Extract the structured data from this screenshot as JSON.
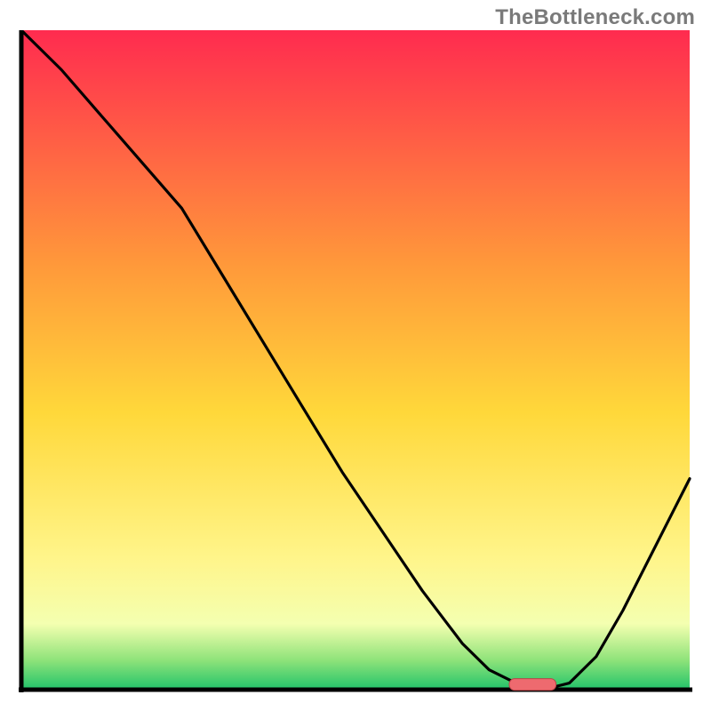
{
  "watermark": "TheBottleneck.com",
  "colors": {
    "gradient_top": "#ff2b4f",
    "gradient_mid_upper": "#ff9a3a",
    "gradient_mid": "#ffd83a",
    "gradient_mid_lower": "#fff58a",
    "gradient_low": "#f4ffb0",
    "gradient_green_light": "#8fe37a",
    "gradient_green": "#21c36a",
    "axis": "#000000",
    "curve": "#000000",
    "marker_fill": "#ee6a6f",
    "marker_stroke": "#b94448"
  },
  "chart_data": {
    "type": "line",
    "title": "",
    "xlabel": "",
    "ylabel": "",
    "xlim": [
      0,
      100
    ],
    "ylim": [
      0,
      100
    ],
    "series": [
      {
        "name": "bottleneck-curve",
        "x": [
          0,
          6,
          12,
          18,
          24,
          30,
          36,
          42,
          48,
          54,
          60,
          66,
          70,
          74,
          78,
          82,
          86,
          90,
          94,
          100
        ],
        "y": [
          100,
          94,
          87,
          80,
          73,
          63,
          53,
          43,
          33,
          24,
          15,
          7,
          3,
          1,
          0,
          1,
          5,
          12,
          20,
          32
        ]
      }
    ],
    "marker": {
      "name": "optimal-band",
      "x_start": 73,
      "x_end": 80,
      "y": 0.8
    },
    "background_gradient_stops": [
      {
        "offset": 0.0,
        "color_key": "gradient_top"
      },
      {
        "offset": 0.36,
        "color_key": "gradient_mid_upper"
      },
      {
        "offset": 0.58,
        "color_key": "gradient_mid"
      },
      {
        "offset": 0.8,
        "color_key": "gradient_mid_lower"
      },
      {
        "offset": 0.9,
        "color_key": "gradient_low"
      },
      {
        "offset": 0.955,
        "color_key": "gradient_green_light"
      },
      {
        "offset": 1.0,
        "color_key": "gradient_green"
      }
    ]
  }
}
